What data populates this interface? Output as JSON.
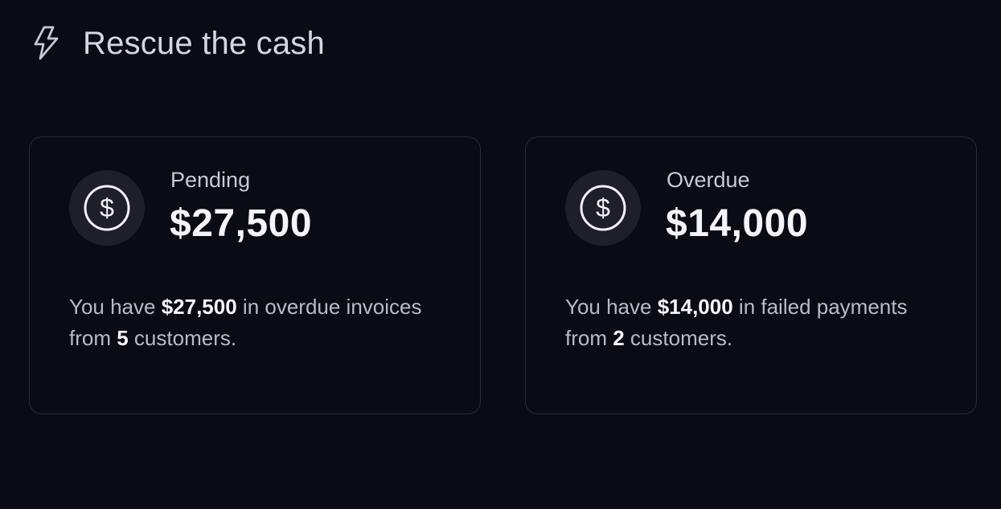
{
  "header": {
    "icon": "lightning-bolt-icon",
    "title": "Rescue the cash"
  },
  "cards": [
    {
      "icon": "dollar-coin-icon",
      "label": "Pending",
      "amount": "$27,500",
      "desc": {
        "prefix": "You have ",
        "amount": "$27,500",
        "middle": " in overdue invoices from ",
        "count": "5",
        "suffix": " customers."
      }
    },
    {
      "icon": "dollar-coin-icon",
      "label": "Overdue",
      "amount": "$14,000",
      "desc": {
        "prefix": "You have ",
        "amount": "$14,000",
        "middle": " in failed payments from ",
        "count": "2",
        "suffix": " customers."
      }
    }
  ],
  "colors": {
    "background": "#0b0b16",
    "card_border": "#2a2a38",
    "icon_circle": "#1f1f2b",
    "text_primary": "#f4f4f8",
    "text_secondary": "#babac8"
  }
}
